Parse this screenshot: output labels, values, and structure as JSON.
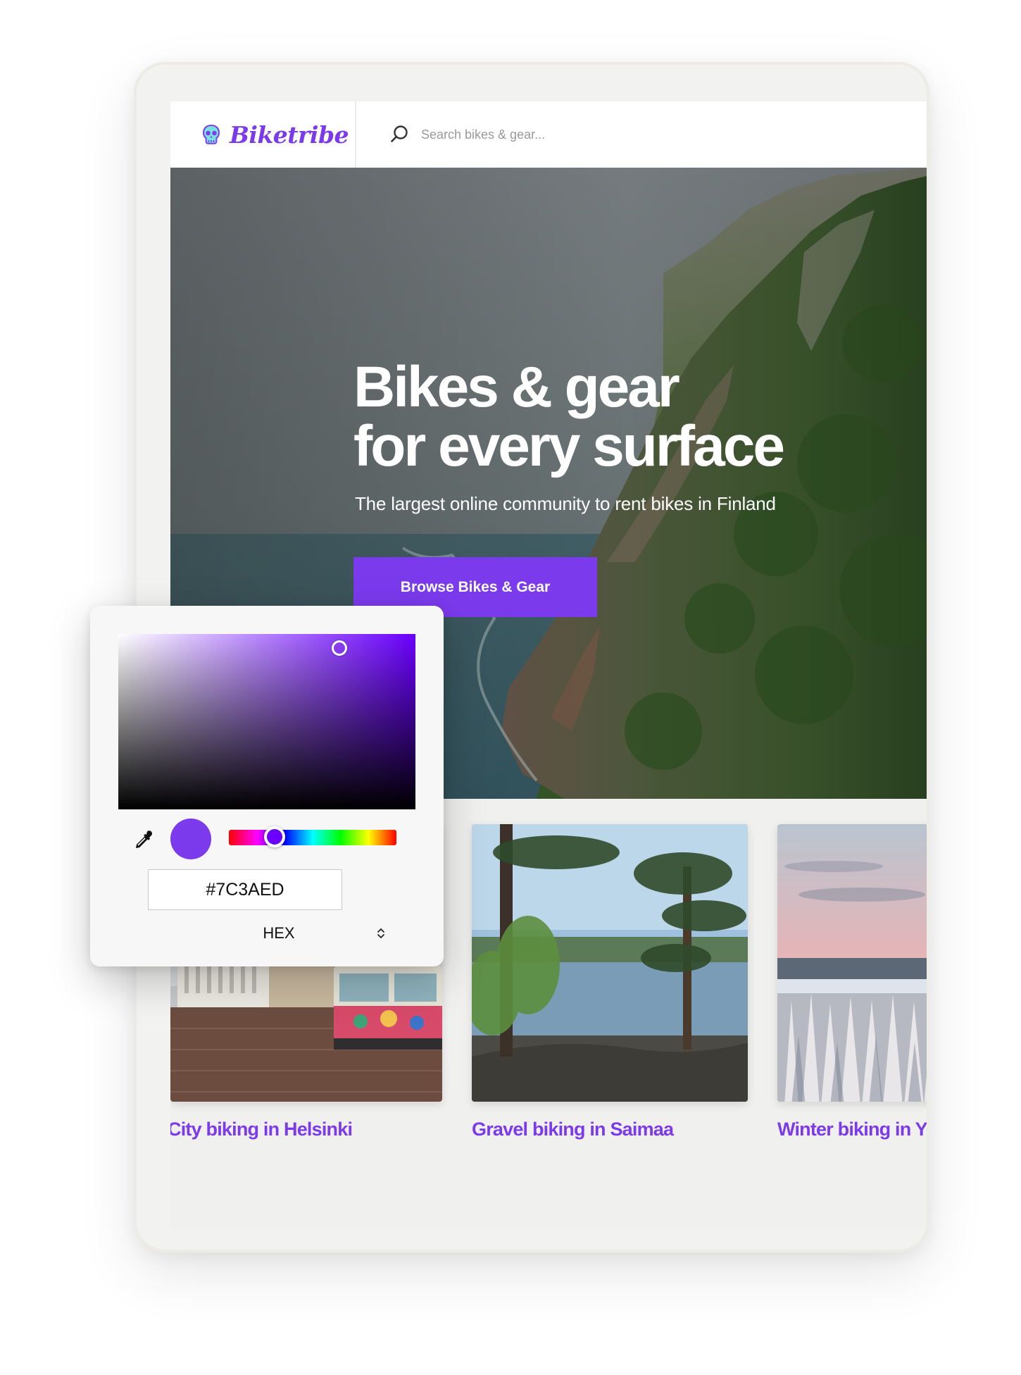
{
  "header": {
    "brand_name": "Biketribe",
    "search_placeholder": "Search bikes & gear..."
  },
  "hero": {
    "title_line1": "Bikes & gear",
    "title_line2": "for every surface",
    "subtitle": "The largest online community to rent bikes in Finland",
    "cta_label": "Browse Bikes & Gear"
  },
  "cards": [
    {
      "title": "City biking in Helsinki"
    },
    {
      "title": "Gravel biking in Saimaa"
    },
    {
      "title": "Winter biking in Y"
    }
  ],
  "color_picker": {
    "hex_value": "#7C3AED",
    "format": "HEX",
    "selected_color": "#7c3aed",
    "hue_color": "#6a00ff"
  },
  "colors": {
    "accent": "#7c3aed",
    "frame": "#f2f2f0",
    "header_bg": "#ffffff"
  },
  "icons": {
    "brand": "skull-logo-icon",
    "search": "search-icon",
    "eyedropper": "eyedropper-icon",
    "format_toggle": "chevron-up-down-icon"
  }
}
